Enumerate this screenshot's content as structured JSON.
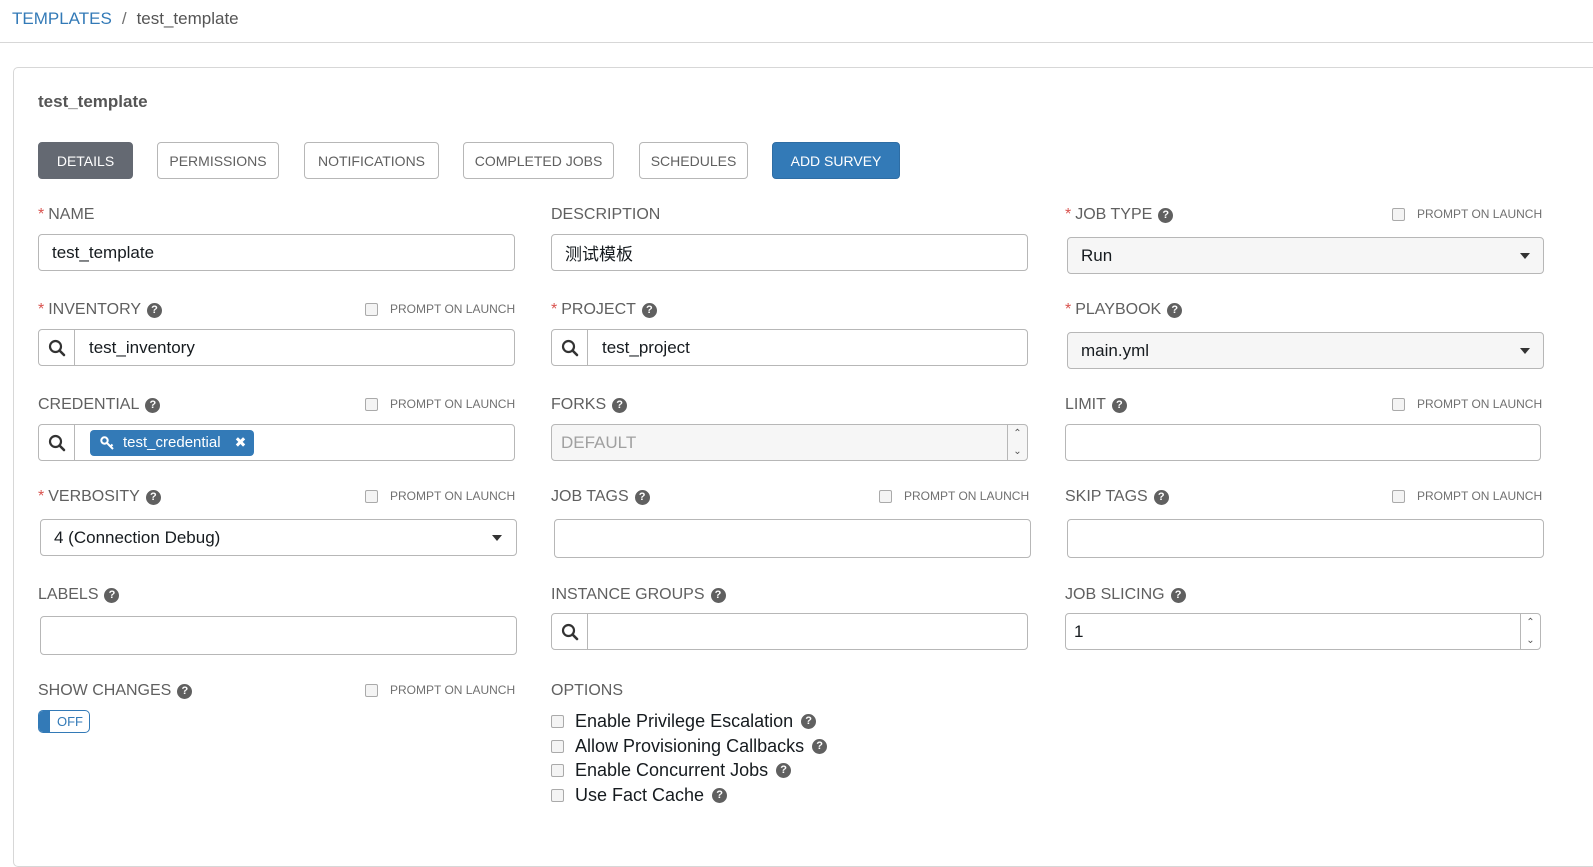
{
  "breadcrumb": {
    "parent": "TEMPLATES",
    "separator": "/",
    "current": "test_template"
  },
  "panel": {
    "title": "test_template"
  },
  "tabs": [
    {
      "label": "DETAILS"
    },
    {
      "label": "PERMISSIONS"
    },
    {
      "label": "NOTIFICATIONS"
    },
    {
      "label": "COMPLETED JOBS"
    },
    {
      "label": "SCHEDULES"
    },
    {
      "label": "ADD SURVEY"
    }
  ],
  "prompt_label": "PROMPT ON LAUNCH",
  "fields": {
    "name": {
      "label": "NAME",
      "value": "test_template"
    },
    "description": {
      "label": "DESCRIPTION",
      "value": "测试模板"
    },
    "job_type": {
      "label": "JOB TYPE",
      "value": "Run"
    },
    "inventory": {
      "label": "INVENTORY",
      "value": "test_inventory"
    },
    "project": {
      "label": "PROJECT",
      "value": "test_project"
    },
    "playbook": {
      "label": "PLAYBOOK",
      "value": "main.yml"
    },
    "credential": {
      "label": "CREDENTIAL",
      "chip": "test_credential"
    },
    "forks": {
      "label": "FORKS",
      "placeholder": "DEFAULT"
    },
    "limit": {
      "label": "LIMIT",
      "value": ""
    },
    "verbosity": {
      "label": "VERBOSITY",
      "value": "4 (Connection Debug)"
    },
    "job_tags": {
      "label": "JOB TAGS",
      "value": ""
    },
    "skip_tags": {
      "label": "SKIP TAGS",
      "value": ""
    },
    "labels": {
      "label": "LABELS",
      "value": ""
    },
    "instance_groups": {
      "label": "INSTANCE GROUPS",
      "value": ""
    },
    "job_slicing": {
      "label": "JOB SLICING",
      "value": "1"
    },
    "show_changes": {
      "label": "SHOW CHANGES",
      "toggle": "OFF"
    }
  },
  "options": {
    "label": "OPTIONS",
    "items": [
      {
        "label": "Enable Privilege Escalation"
      },
      {
        "label": "Allow Provisioning Callbacks"
      },
      {
        "label": "Enable Concurrent Jobs"
      },
      {
        "label": "Use Fact Cache"
      }
    ]
  },
  "colors": {
    "primary": "#337ab7",
    "active_tab": "#646972",
    "required": "#d9534f"
  },
  "icons": {
    "search": "search-icon",
    "help": "question-circle-icon",
    "key": "key-icon",
    "remove": "remove-icon"
  }
}
